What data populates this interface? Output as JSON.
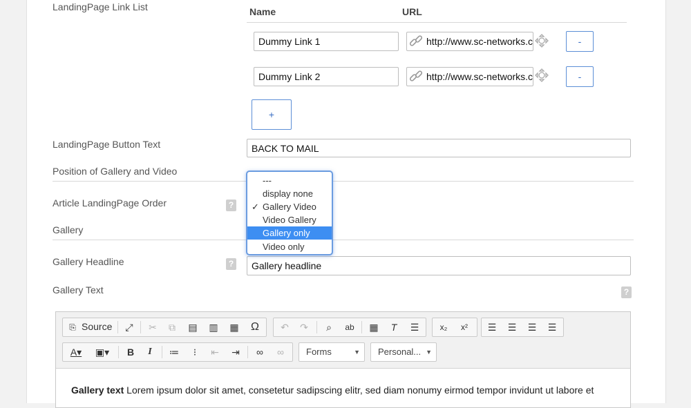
{
  "link_list": {
    "label": "LandingPage Link List",
    "name_header": "Name",
    "url_header": "URL",
    "rows": [
      {
        "name": "Dummy Link 1",
        "url": "http://www.sc-networks.c",
        "remove_label": "-"
      },
      {
        "name": "Dummy Link 2",
        "url": "http://www.sc-networks.c",
        "remove_label": "-"
      }
    ],
    "add_label": "+"
  },
  "button_text": {
    "label": "LandingPage Button Text",
    "value": "BACK TO MAIL"
  },
  "position": {
    "label": "Position of Gallery and Video",
    "options": [
      "---",
      "display none",
      "Gallery Video",
      "Video Gallery",
      "Gallery only",
      "Video only"
    ],
    "checked": "Gallery Video",
    "highlighted": "Gallery only",
    "checkmark": "✓"
  },
  "order": {
    "label": "Article LandingPage Order"
  },
  "gallery": {
    "label": "Gallery"
  },
  "gallery_headline": {
    "label": "Gallery Headline",
    "value": "Gallery headline"
  },
  "gallery_text": {
    "label": "Gallery Text"
  },
  "help_glyph": "?",
  "editor": {
    "source_label": "Source",
    "forms_label": "Forms",
    "personal_label": "Personal...",
    "content_bold": "Gallery text",
    "content_text": " Lorem ipsum dolor sit amet, consetetur sadipscing elitr, sed diam nonumy eirmod tempor invidunt ut labore et"
  },
  "colors": {
    "accent": "#3d8ef2",
    "border_blue": "#5b8ed6"
  }
}
